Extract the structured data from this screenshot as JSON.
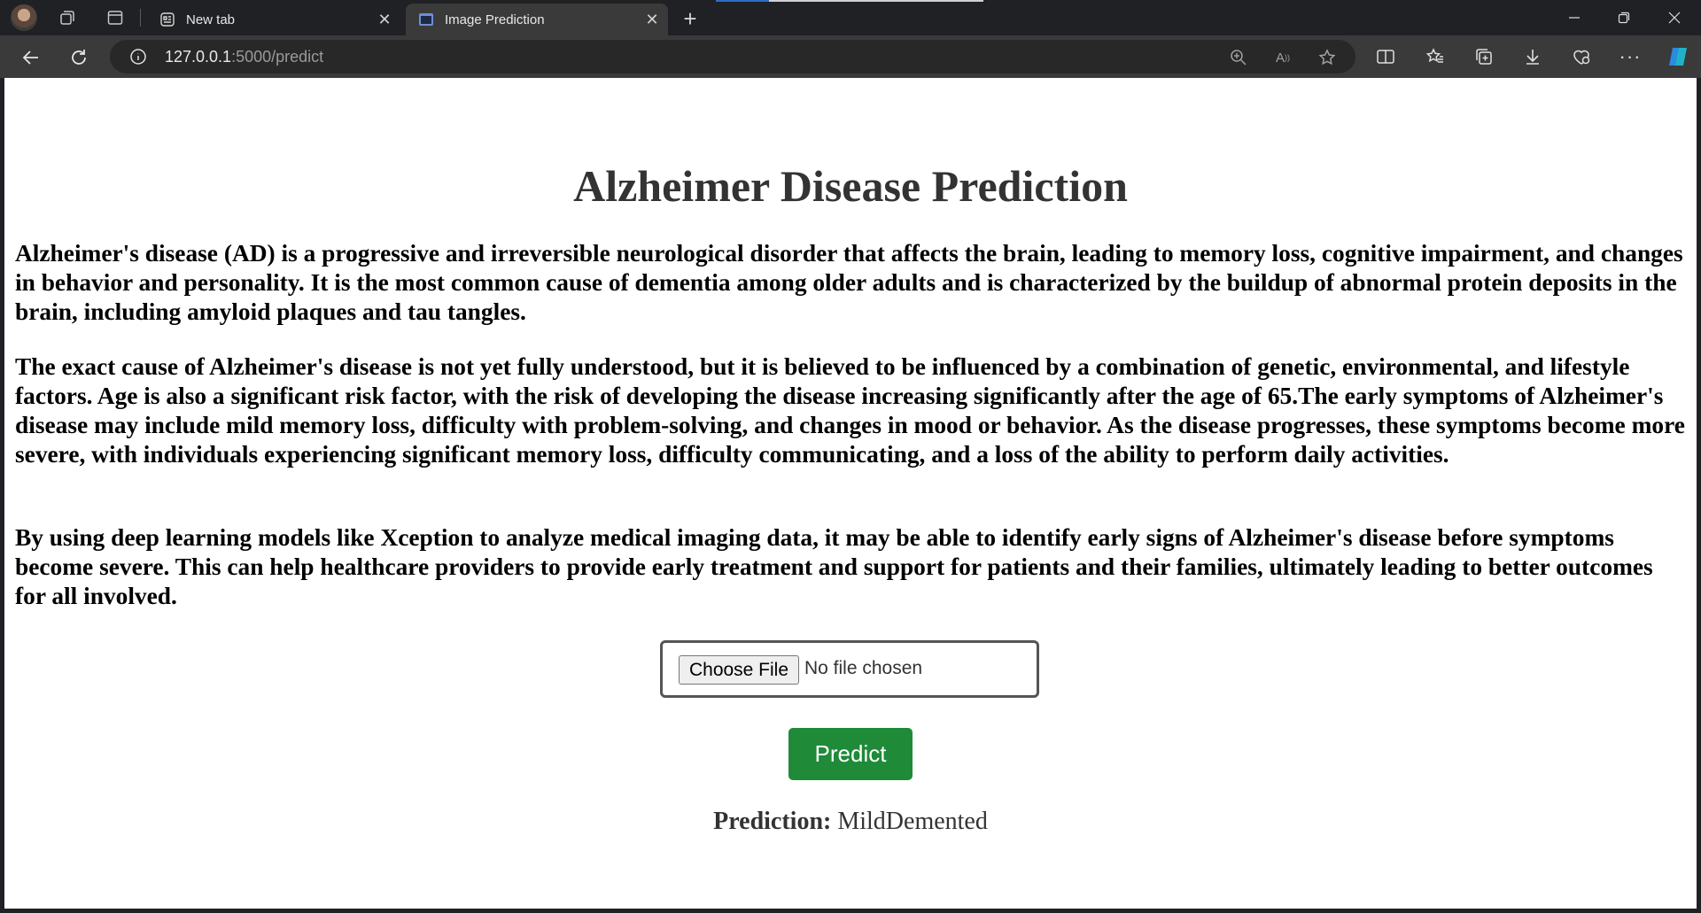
{
  "browser": {
    "tabs": [
      {
        "label": "New tab",
        "active": false
      },
      {
        "label": "Image Prediction",
        "active": true
      }
    ],
    "address": {
      "host": "127.0.0.1",
      "path": ":5000/predict"
    }
  },
  "page": {
    "title": "Alzheimer Disease Prediction",
    "paragraphs": [
      "Alzheimer's disease (AD) is a progressive and irreversible neurological disorder that affects the brain, leading to memory loss, cognitive impairment, and changes in behavior and personality. It is the most common cause of dementia among older adults and is characterized by the buildup of abnormal protein deposits in the brain, including amyloid plaques and tau tangles.",
      "The exact cause of Alzheimer's disease is not yet fully understood, but it is believed to be influenced by a combination of genetic, environmental, and lifestyle factors. Age is also a significant risk factor, with the risk of developing the disease increasing significantly after the age of 65.The early symptoms of Alzheimer's disease may include mild memory loss, difficulty with problem-solving, and changes in mood or behavior. As the disease progresses, these symptoms become more severe, with individuals experiencing significant memory loss, difficulty communicating, and a loss of the ability to perform daily activities.",
      "By using deep learning models like Xception to analyze medical imaging data, it may be able to identify early signs of Alzheimer's disease before symptoms become severe. This can help healthcare providers to provide early treatment and support for patients and their families, ultimately leading to better outcomes for all involved."
    ],
    "file_input": {
      "button_label": "Choose File",
      "status": "No file chosen"
    },
    "predict_button": "Predict",
    "prediction": {
      "label": "Prediction:",
      "value": "MildDemented"
    },
    "colors": {
      "predict_button": "#1f8a38",
      "title": "#333333"
    }
  }
}
